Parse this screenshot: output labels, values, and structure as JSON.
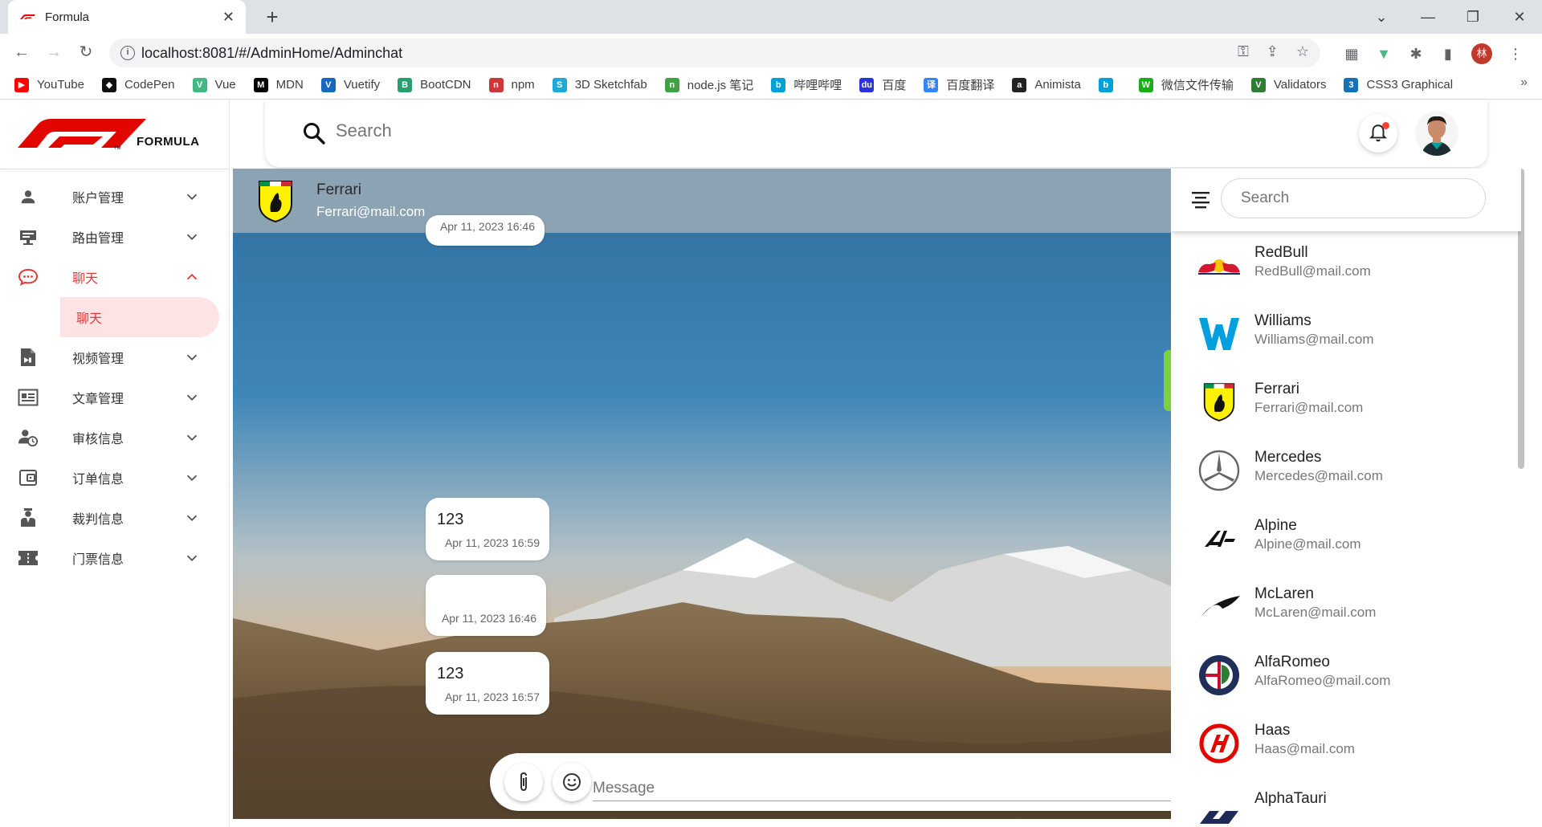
{
  "browser": {
    "tab_title": "Formula",
    "url": "localhost:8081/#/AdminHome/Adminchat",
    "profile_initial": "林",
    "bookmarks": [
      {
        "label": "YouTube",
        "color": "#ff0000",
        "glyph": "▶"
      },
      {
        "label": "CodePen",
        "color": "#111111",
        "glyph": "◆"
      },
      {
        "label": "Vue",
        "color": "#42b883",
        "glyph": "V"
      },
      {
        "label": "MDN",
        "color": "#000000",
        "glyph": "M"
      },
      {
        "label": "Vuetify",
        "color": "#1867c0",
        "glyph": "V"
      },
      {
        "label": "BootCDN",
        "color": "#2a9d6f",
        "glyph": "B"
      },
      {
        "label": "npm",
        "color": "#cb3837",
        "glyph": "n"
      },
      {
        "label": "3D Sketchfab",
        "color": "#1caad9",
        "glyph": "S"
      },
      {
        "label": "node.js 笔记",
        "color": "#43a047",
        "glyph": "n"
      },
      {
        "label": "哔哩哔哩",
        "color": "#00a1d6",
        "glyph": "b"
      },
      {
        "label": "百度",
        "color": "#2932e1",
        "glyph": "du"
      },
      {
        "label": "百度翻译",
        "color": "#3385ff",
        "glyph": "译"
      },
      {
        "label": "Animista",
        "color": "#222222",
        "glyph": "a"
      },
      {
        "label": "",
        "color": "#00a1d6",
        "glyph": "b"
      },
      {
        "label": "微信文件传输",
        "color": "#1aad19",
        "glyph": "W"
      },
      {
        "label": "Validators",
        "color": "#2e7d32",
        "glyph": "V"
      },
      {
        "label": "CSS3 Graphical",
        "color": "#1572b6",
        "glyph": "3"
      }
    ]
  },
  "app": {
    "logo_text": "FORMULA",
    "search_placeholder": "Search",
    "menu": [
      {
        "label": "账户管理",
        "icon": "person-icon",
        "expanded": false
      },
      {
        "label": "路由管理",
        "icon": "router-icon",
        "expanded": false
      },
      {
        "label": "聊天",
        "icon": "chat-icon",
        "expanded": true
      },
      {
        "label": "视频管理",
        "icon": "video-file-icon",
        "expanded": false
      },
      {
        "label": "文章管理",
        "icon": "article-icon",
        "expanded": false
      },
      {
        "label": "审核信息",
        "icon": "review-icon",
        "expanded": false
      },
      {
        "label": "订单信息",
        "icon": "wallet-icon",
        "expanded": false
      },
      {
        "label": "裁判信息",
        "icon": "referee-icon",
        "expanded": false
      },
      {
        "label": "门票信息",
        "icon": "ticket-icon",
        "expanded": false
      }
    ],
    "submenu_active": "聊天",
    "accent": "#e53935"
  },
  "chat": {
    "contact_name": "Ferrari",
    "contact_email": "Ferrari@mail.com",
    "messages": [
      {
        "text": "",
        "time": "Apr 11, 2023 16:46"
      },
      {
        "text": "123",
        "time": "Apr 11, 2023 16:59"
      },
      {
        "text": "",
        "time": "Apr 11, 2023 16:46"
      },
      {
        "text": "123",
        "time": "Apr 11, 2023 16:57"
      }
    ],
    "message_placeholder": "Message"
  },
  "contacts": {
    "search_placeholder": "Search",
    "list": [
      {
        "name": "RedBull",
        "email": "RedBull@mail.com",
        "icon": "redbull-logo-icon"
      },
      {
        "name": "Williams",
        "email": "Williams@mail.com",
        "icon": "williams-logo-icon"
      },
      {
        "name": "Ferrari",
        "email": "Ferrari@mail.com",
        "icon": "ferrari-logo-icon"
      },
      {
        "name": "Mercedes",
        "email": "Mercedes@mail.com",
        "icon": "mercedes-logo-icon"
      },
      {
        "name": "Alpine",
        "email": "Alpine@mail.com",
        "icon": "alpine-logo-icon"
      },
      {
        "name": "McLaren",
        "email": "McLaren@mail.com",
        "icon": "mclaren-logo-icon"
      },
      {
        "name": "AlfaRomeo",
        "email": "AlfaRomeo@mail.com",
        "icon": "alfaromeo-logo-icon"
      },
      {
        "name": "Haas",
        "email": "Haas@mail.com",
        "icon": "haas-logo-icon"
      },
      {
        "name": "AlphaTauri",
        "email": "",
        "icon": "alphatauri-logo-icon"
      }
    ]
  }
}
